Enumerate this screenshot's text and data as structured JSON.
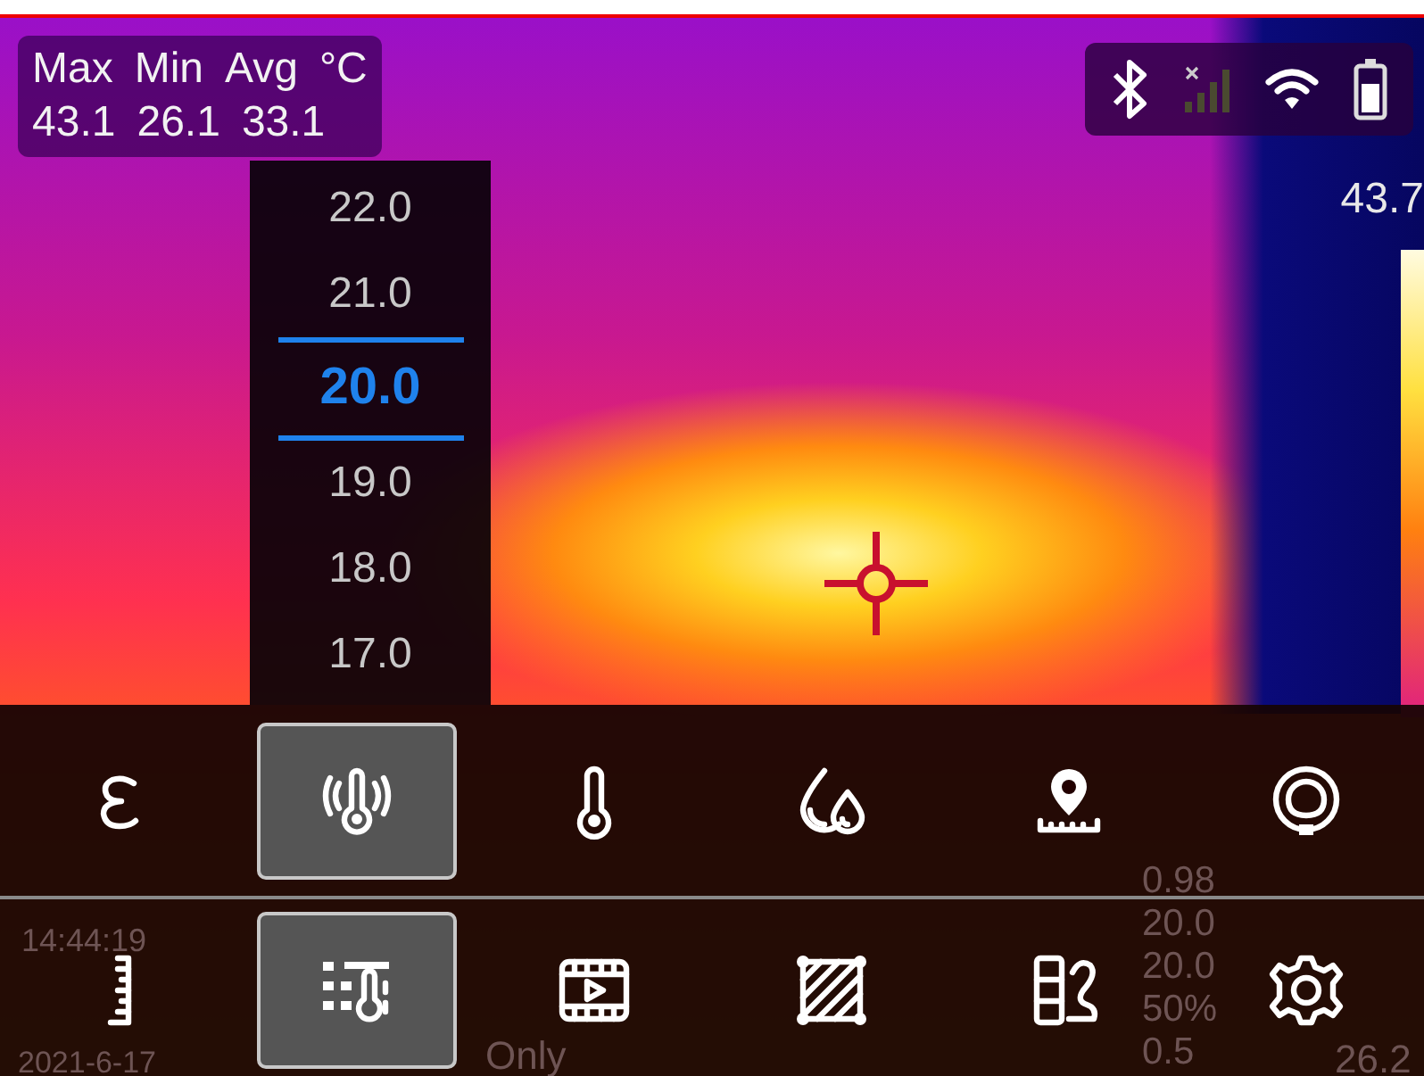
{
  "stats": {
    "labels": [
      "Max",
      "Min",
      "Avg"
    ],
    "unit": "°C",
    "values": [
      "43.1",
      "26.1",
      "33.1"
    ]
  },
  "status_icons": [
    {
      "kind": "bluetooth"
    },
    {
      "kind": "signal"
    },
    {
      "kind": "wifi"
    },
    {
      "kind": "battery"
    }
  ],
  "scale": {
    "max": "43.7"
  },
  "picker": {
    "items": [
      {
        "label": "22.0",
        "selected": false
      },
      {
        "label": "21.0",
        "selected": false
      },
      {
        "label": "20.0",
        "selected": true
      },
      {
        "label": "19.0",
        "selected": false
      },
      {
        "label": "18.0",
        "selected": false
      },
      {
        "label": "17.0",
        "selected": false
      }
    ]
  },
  "overlay_info": {
    "time": "14:44:19",
    "date": "2021-6-17",
    "mode": "Only",
    "parameters": [
      "0.98",
      "20.0",
      "20.0",
      "50%",
      "0.5"
    ],
    "spot_temp": "26.2"
  },
  "toolbar": {
    "rows": [
      [
        {
          "kind": "emissivity",
          "selected": false
        },
        {
          "kind": "reflected",
          "selected": true
        },
        {
          "kind": "thermometer",
          "selected": false
        },
        {
          "kind": "humidity",
          "selected": false
        },
        {
          "kind": "distance",
          "selected": false
        },
        {
          "kind": "lens",
          "selected": false
        }
      ],
      [
        {
          "kind": "ruler",
          "selected": false
        },
        {
          "kind": "palette",
          "selected": true
        },
        {
          "kind": "video",
          "selected": false
        },
        {
          "kind": "area",
          "selected": false
        },
        {
          "kind": "layout",
          "selected": false
        },
        {
          "kind": "settings",
          "selected": false
        }
      ]
    ]
  }
}
